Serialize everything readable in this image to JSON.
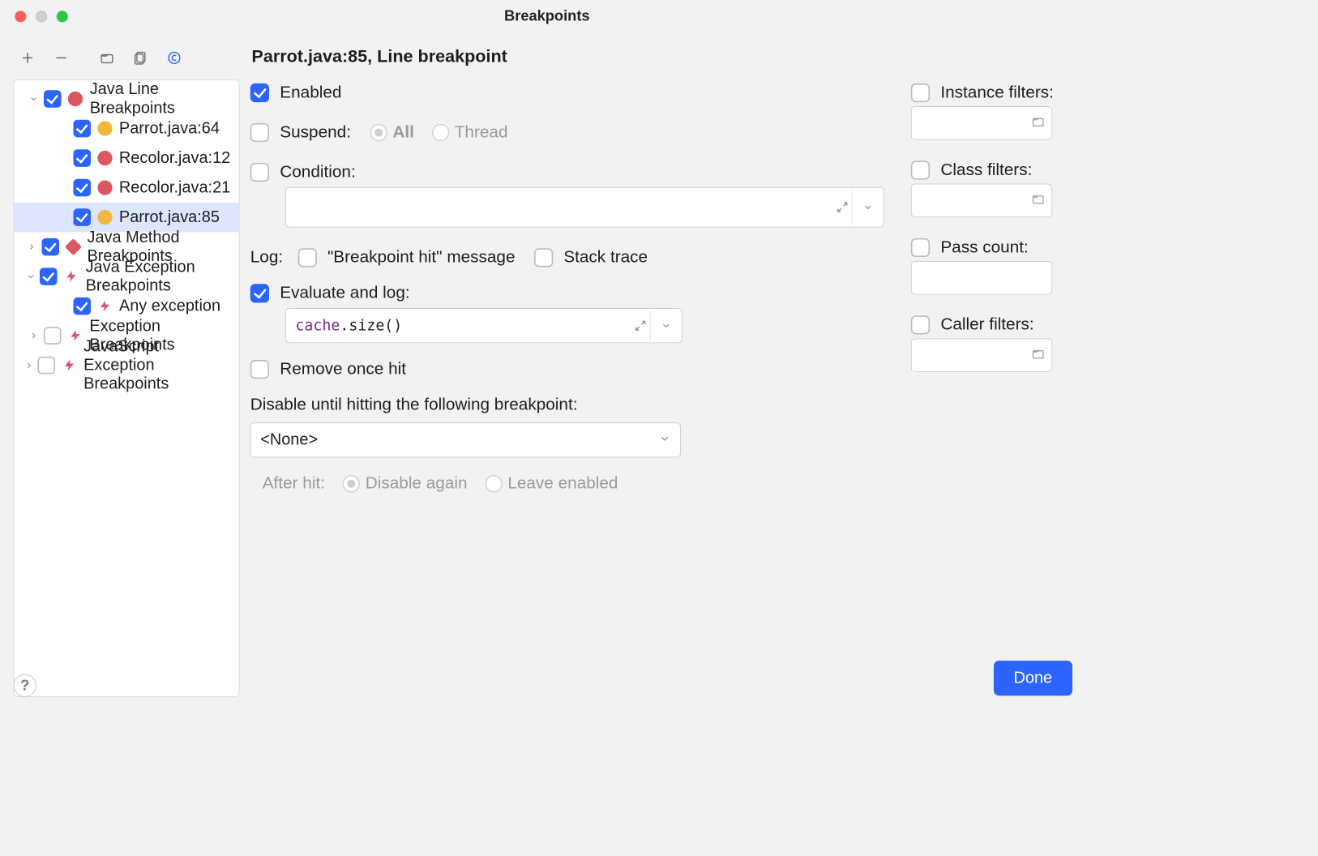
{
  "window": {
    "title": "Breakpoints"
  },
  "tree": {
    "groups": [
      {
        "label": "Java Line Breakpoints",
        "checked": true,
        "expanded": true,
        "icon": "bp-red",
        "items": [
          {
            "label": "Parrot.java:64",
            "checked": true,
            "icon": "bp-yellow",
            "selected": false
          },
          {
            "label": "Recolor.java:12",
            "checked": true,
            "icon": "bp-red",
            "selected": false
          },
          {
            "label": "Recolor.java:21",
            "checked": true,
            "icon": "bp-red",
            "selected": false
          },
          {
            "label": "Parrot.java:85",
            "checked": true,
            "icon": "bp-yellow",
            "selected": true
          }
        ]
      },
      {
        "label": "Java Method Breakpoints",
        "checked": true,
        "expanded": false,
        "icon": "bp-diamond",
        "items": []
      },
      {
        "label": "Java Exception Breakpoints",
        "checked": true,
        "expanded": true,
        "icon": "bolt",
        "items": [
          {
            "label": "Any exception",
            "checked": true,
            "icon": "bolt",
            "selected": false
          }
        ]
      },
      {
        "label": "Exception Breakpoints",
        "checked": false,
        "expanded": false,
        "icon": "bolt",
        "items": []
      },
      {
        "label": "JavaScript Exception Breakpoints",
        "checked": false,
        "expanded": false,
        "icon": "bolt",
        "items": []
      }
    ]
  },
  "details": {
    "title": "Parrot.java:85, Line breakpoint",
    "enabled": {
      "label": "Enabled",
      "checked": true
    },
    "suspend": {
      "label": "Suspend:",
      "checked": false,
      "all": "All",
      "thread": "Thread",
      "selected": "all"
    },
    "condition": {
      "label": "Condition:",
      "checked": false,
      "value": ""
    },
    "log": {
      "label": "Log:",
      "bp_hit_label": "\"Breakpoint hit\" message",
      "bp_hit_checked": false,
      "stack_label": "Stack trace",
      "stack_checked": false
    },
    "eval": {
      "label": "Evaluate and log:",
      "checked": true,
      "value_id": "cache",
      "value_rest": ".size()"
    },
    "remove": {
      "label": "Remove once hit",
      "checked": false
    },
    "disable": {
      "label": "Disable until hitting the following breakpoint:",
      "value": "<None>"
    },
    "after": {
      "label": "After hit:",
      "disable_again": "Disable again",
      "leave": "Leave enabled",
      "selected": "disable"
    },
    "filters": {
      "instance": {
        "label": "Instance filters:",
        "checked": false
      },
      "class": {
        "label": "Class filters:",
        "checked": false
      },
      "pass": {
        "label": "Pass count:",
        "checked": false
      },
      "caller": {
        "label": "Caller filters:",
        "checked": false
      }
    }
  },
  "footer": {
    "done": "Done"
  }
}
